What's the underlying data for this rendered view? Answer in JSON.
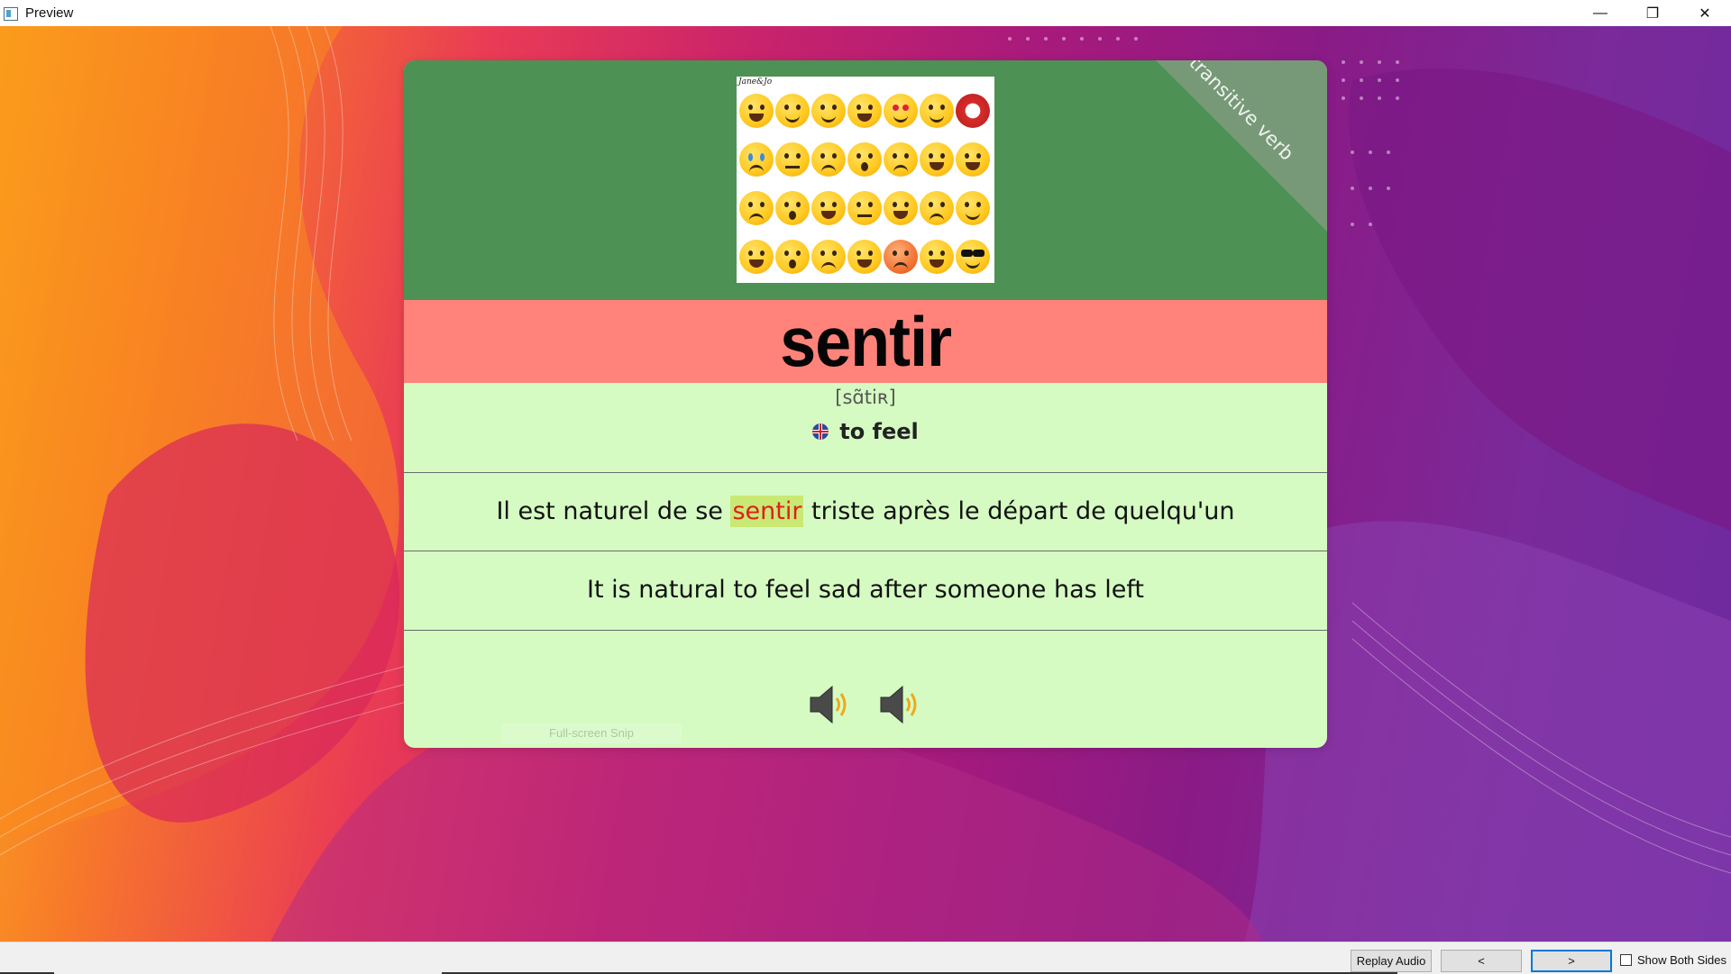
{
  "window": {
    "title": "Preview",
    "controls": {
      "minimize": "—",
      "restore": "❐",
      "close": "✕"
    }
  },
  "card": {
    "corner_label": "transitive verb",
    "image_brand": "Jane&Jo",
    "word": "sentir",
    "phonetic": "[sɑ̃tiʀ]",
    "meaning": "to feel",
    "example": {
      "before": "Il est naturel de se ",
      "highlight": "sentir",
      "after": " triste après le départ de quelqu'un"
    },
    "translation": "It is natural to feel sad after someone has left",
    "ghost_text": "Full-screen Snip",
    "colors": {
      "top": "#4d9155",
      "word_band": "#ff837a",
      "body": "#d5fbc2",
      "highlight_bg": "#c9e874",
      "highlight_text": "#e11d1d"
    }
  },
  "icons": {
    "flag": "uk-flag-icon",
    "speaker": "speaker-icon"
  },
  "bottom_bar": {
    "replay_label": "Replay Audio",
    "prev_label": "<",
    "next_label": ">",
    "show_both_label": "Show Both Sides",
    "show_both_checked": false
  }
}
